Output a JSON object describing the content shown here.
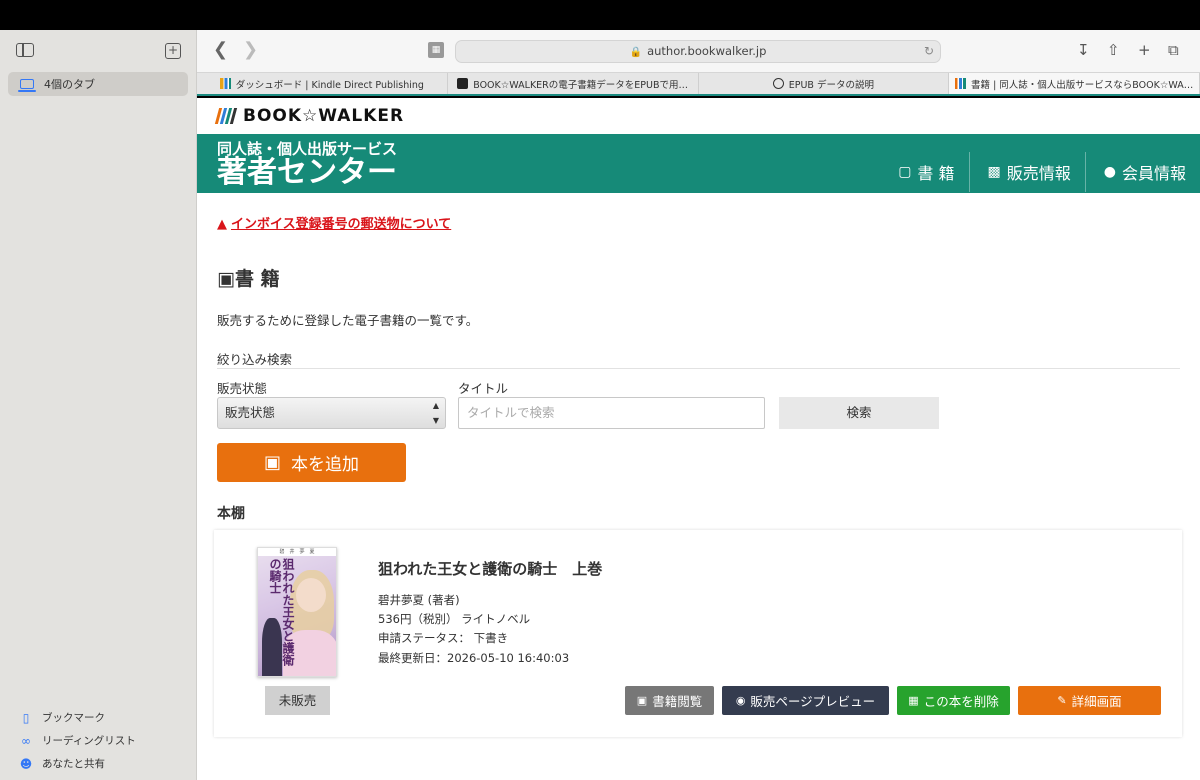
{
  "sidebar": {
    "tab_group_label": "4個のタブ",
    "bottom_links": [
      {
        "label": "ブックマーク",
        "icon": "bookmark-icon"
      },
      {
        "label": "リーディングリスト",
        "icon": "glasses-icon"
      },
      {
        "label": "あなたと共有",
        "icon": "shared-with-you-icon"
      }
    ]
  },
  "browser": {
    "url": "author.bookwalker.jp",
    "tabs": [
      {
        "label": "ダッシュボード | Kindle Direct Publishing",
        "active": false
      },
      {
        "label": "BOOK☆WALKERの電子書籍データをEPUBで用…",
        "active": false
      },
      {
        "label": "EPUB データの説明",
        "active": false
      },
      {
        "label": "書籍 | 同人誌・個人出版サービスならBOOK☆WA…",
        "active": true
      }
    ]
  },
  "site": {
    "logo_text": "BOOK☆WALKER",
    "banner_sub": "同人誌・個人出版サービス",
    "banner_main": "著者センター",
    "nav": [
      {
        "label": "書 籍",
        "icon": "book-icon"
      },
      {
        "label": "販売情報",
        "icon": "bar-chart-icon"
      },
      {
        "label": "会員情報",
        "icon": "user-icon"
      }
    ],
    "colors": {
      "brand_green": "#168a78",
      "accent_orange": "#e8700e",
      "warning_red": "#d9141a"
    }
  },
  "notice": {
    "text": "インボイス登録番号の郵送物について"
  },
  "section": {
    "title": "書 籍",
    "description": "販売するために登録した電子書籍の一覧です。"
  },
  "filter": {
    "title": "絞り込み検索",
    "status_label": "販売状態",
    "status_selected": "販売状態",
    "title_label": "タイトル",
    "title_placeholder": "タイトルで検索",
    "search_button": "検索"
  },
  "add_button": "本を追加",
  "shelf": {
    "title": "本棚",
    "books": [
      {
        "title": "狙われた王女と護衛の騎士　上巻",
        "author": "碧井夢夏 (著者)",
        "price_genre": "536円（税別） ライトノベル",
        "status": "申請ステータス： 下書き",
        "updated": "最終更新日：2026-05-10 16:40:03",
        "sale_status": "未販売",
        "cover_top": "碧　井　夢　夏",
        "cover_title": "狙われた王女と護衛の騎士",
        "actions": {
          "view": "書籍閲覧",
          "preview": "販売ページプレビュー",
          "delete": "この本を削除",
          "detail": "詳細画面"
        }
      }
    ]
  }
}
